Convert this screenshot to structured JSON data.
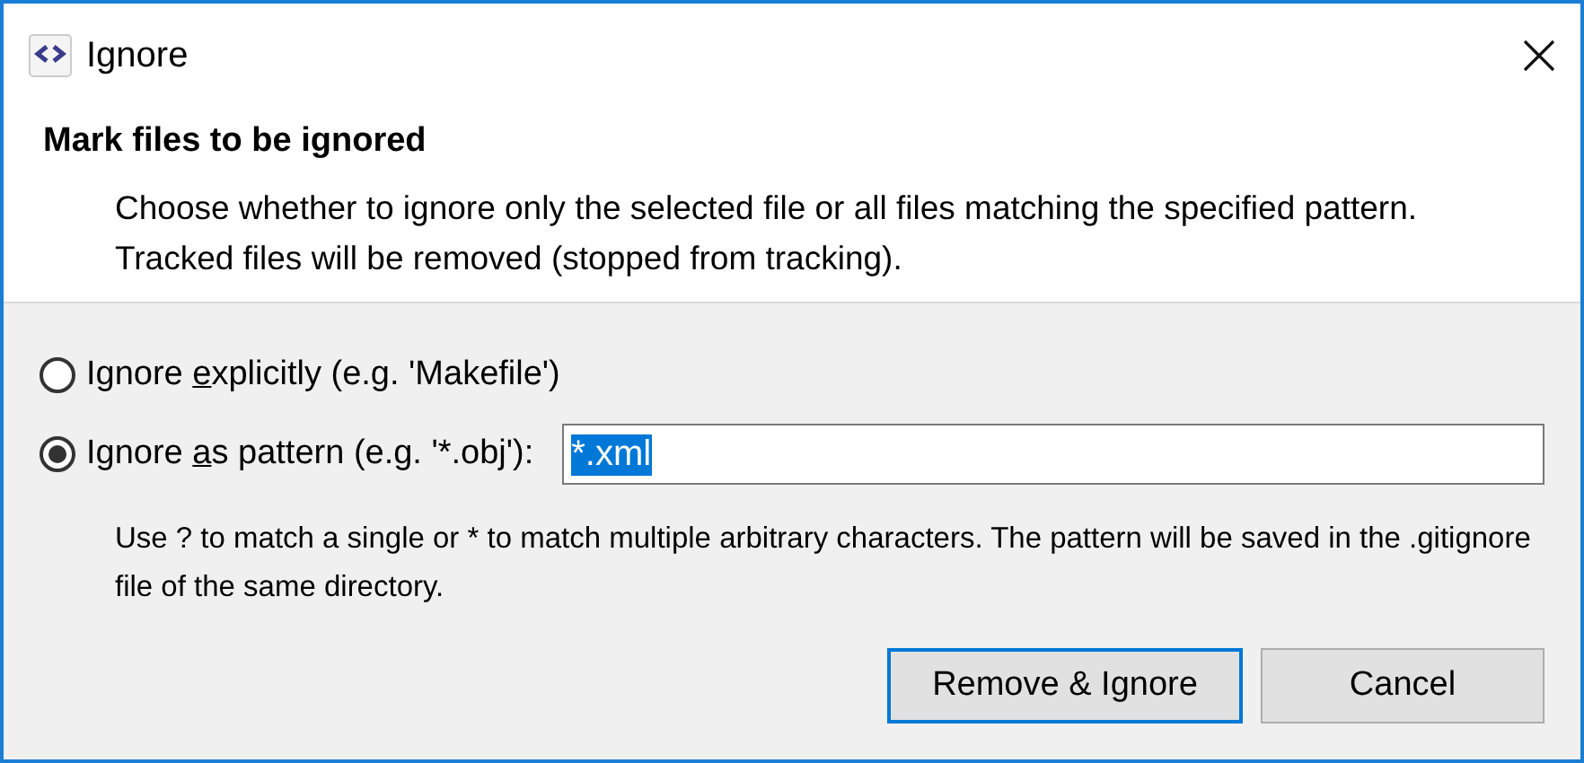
{
  "window": {
    "title": "Ignore"
  },
  "header": {
    "title": "Mark files to be ignored",
    "description": "Choose whether to ignore only the selected file or all files matching the specified pattern. Tracked files will be removed (stopped from tracking)."
  },
  "options": [
    {
      "before": "Ignore ",
      "mnemonic": "e",
      "after": "xplicitly (e.g. 'Makefile')",
      "selected": false
    },
    {
      "before": "Ignore ",
      "mnemonic": "a",
      "after": "s pattern (e.g. '*.obj'):",
      "selected": true,
      "value": "*.xml",
      "value_selected": true
    }
  ],
  "hint": "Use ? to match a single or * to match multiple arbitrary characters. The pattern will be saved in the .gitignore file of the same directory.",
  "buttons": [
    {
      "label": "Remove & Ignore",
      "default": true
    },
    {
      "label": "Cancel",
      "default": false
    }
  ]
}
